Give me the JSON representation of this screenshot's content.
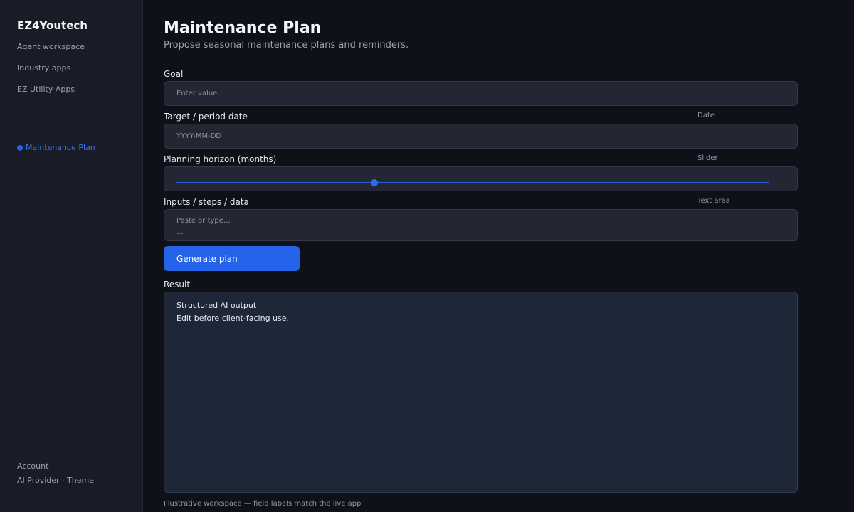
{
  "sidebar": {
    "brand": "EZ4Youtech",
    "nav": [
      {
        "label": "Agent workspace"
      },
      {
        "label": "Industry apps"
      },
      {
        "label": "EZ Utility Apps"
      }
    ],
    "active": {
      "label": "Maintenance Plan"
    },
    "footer": {
      "account": "Account",
      "provider_theme": "AI Provider · Theme"
    }
  },
  "page": {
    "title": "Maintenance Plan",
    "subtitle": "Propose seasonal maintenance plans and reminders."
  },
  "form": {
    "goal": {
      "label": "Goal",
      "placeholder": "Enter value..."
    },
    "date": {
      "label": "Target / period date",
      "type_hint": "Date",
      "placeholder": "YYYY-MM-DD"
    },
    "horizon": {
      "label": "Planning horizon (months)",
      "type_hint": "Slider",
      "value_fraction": 0.334
    },
    "inputs": {
      "label": "Inputs / steps / data",
      "type_hint": "Text area",
      "placeholder_line1": "Paste or type...",
      "placeholder_line2": "..."
    },
    "submit_label": "Generate plan"
  },
  "result": {
    "label": "Result",
    "line1": "Structured AI output",
    "line2": "Edit before client-facing use."
  },
  "footer_note": "Illustrative workspace — field labels match the live app",
  "colors": {
    "accent": "#2563eb",
    "background": "#0e1118",
    "sidebar": "#191b26",
    "field": "#242733",
    "result_panel": "#1e2738"
  }
}
